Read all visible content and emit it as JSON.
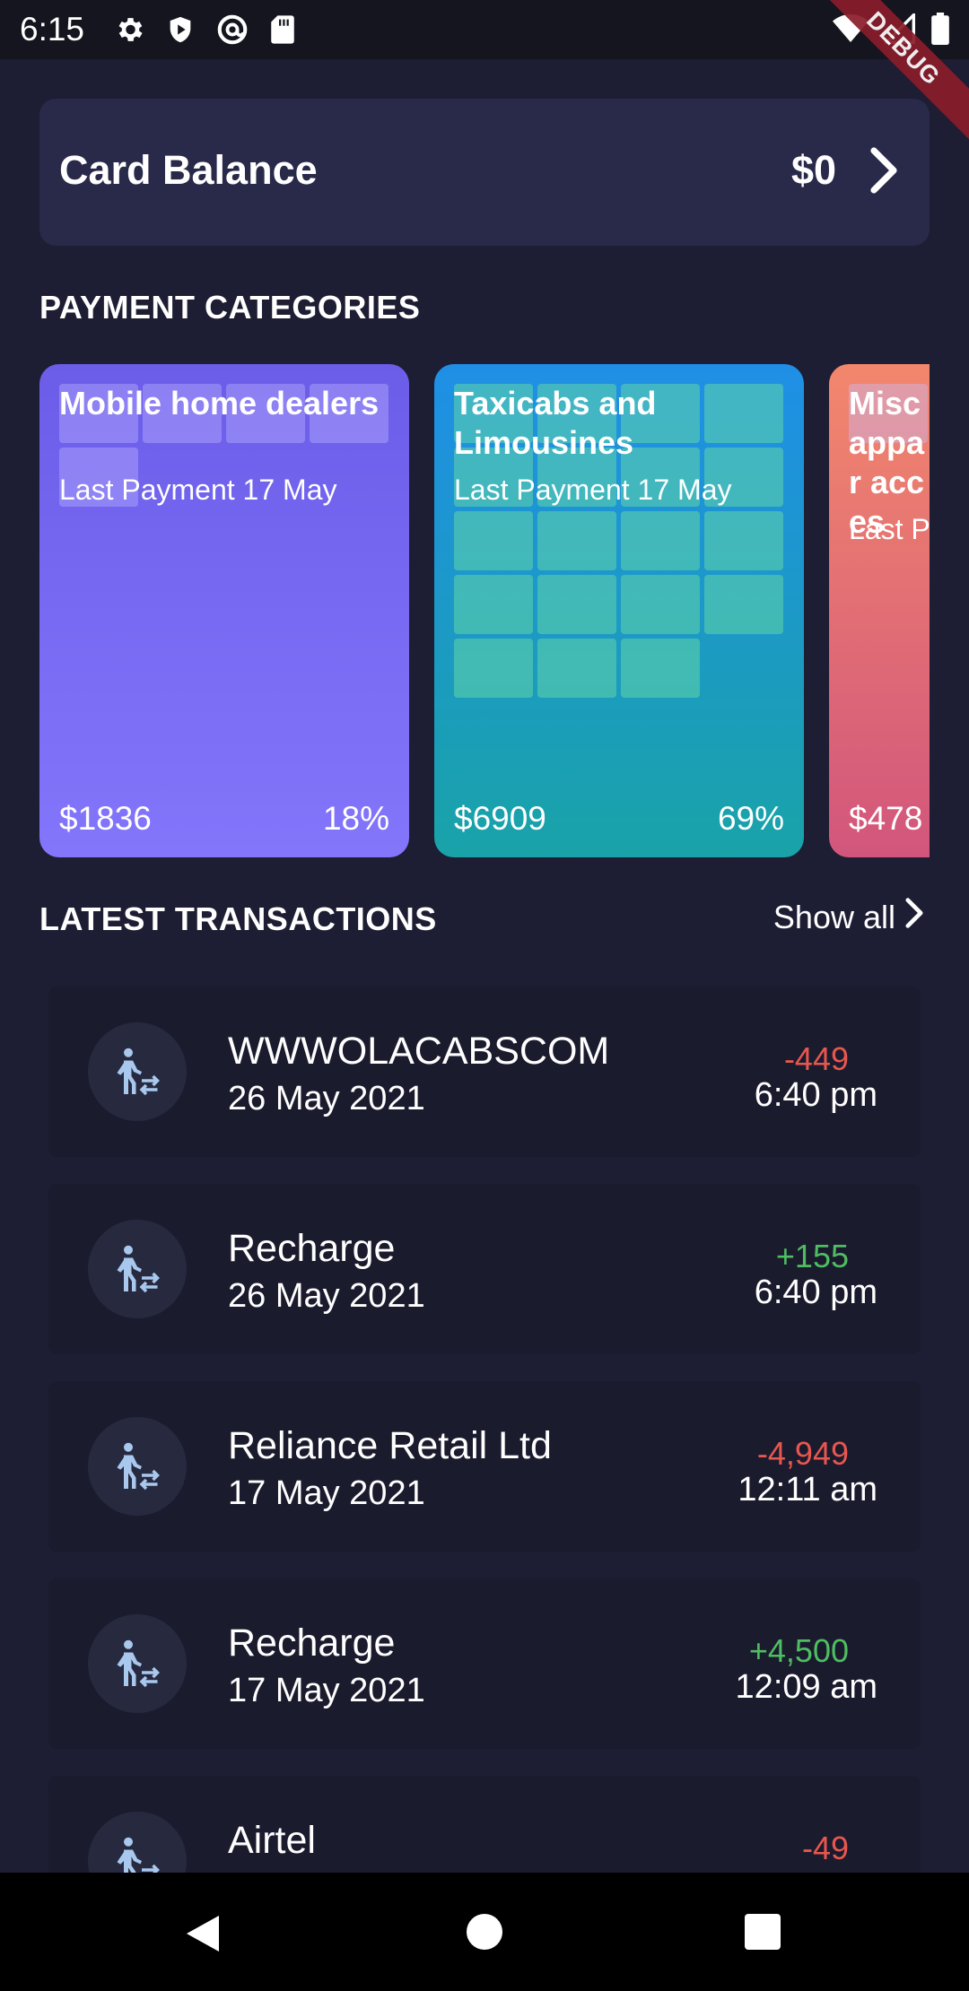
{
  "status_bar": {
    "time": "6:15",
    "debug_label": "DEBUG",
    "left_icons": [
      "gear-icon",
      "shield-play-icon",
      "at-circle-icon",
      "sd-card-icon"
    ],
    "right_icons": [
      "wifi-icon",
      "signal-icon",
      "battery-icon"
    ]
  },
  "balance": {
    "title": "Card Balance",
    "value": "$0"
  },
  "categories": {
    "title": "PAYMENT CATEGORIES",
    "items": [
      {
        "name": "Mobile home dealers",
        "last_payment": "Last Payment 17 May",
        "amount": "$1836",
        "percent": "18%",
        "percent_value": 18,
        "color": "#7b6cf6"
      },
      {
        "name": "Taxicabs and Limousines",
        "last_payment": "Last Payment 17 May",
        "amount": "$6909",
        "percent": "69%",
        "percent_value": 69,
        "color": "#1a9fc0"
      },
      {
        "name": "Misc appar acces",
        "last_payment": "Last P",
        "amount": "$478",
        "percent": "",
        "color": "#e8706f"
      }
    ]
  },
  "transactions": {
    "title": "LATEST TRANSACTIONS",
    "show_all": "Show all",
    "items": [
      {
        "name": "WWWOLACABSCOM",
        "date": "26 May 2021",
        "amount": "-449",
        "time": "6:40 pm",
        "type": "debit"
      },
      {
        "name": "Recharge",
        "date": "26 May 2021",
        "amount": "+155",
        "time": "6:40 pm",
        "type": "credit"
      },
      {
        "name": "Reliance Retail Ltd",
        "date": "17 May 2021",
        "amount": "-4,949",
        "time": "12:11 am",
        "type": "debit"
      },
      {
        "name": "Recharge",
        "date": "17 May 2021",
        "amount": "+4,500",
        "time": "12:09 am",
        "type": "credit"
      },
      {
        "name": "Airtel",
        "date": "",
        "amount": "-49",
        "time": "",
        "type": "debit"
      }
    ]
  },
  "colors": {
    "background": "#1d1d33",
    "card": "#29294a",
    "debit": "#e8574f",
    "credit": "#4fbd62"
  }
}
